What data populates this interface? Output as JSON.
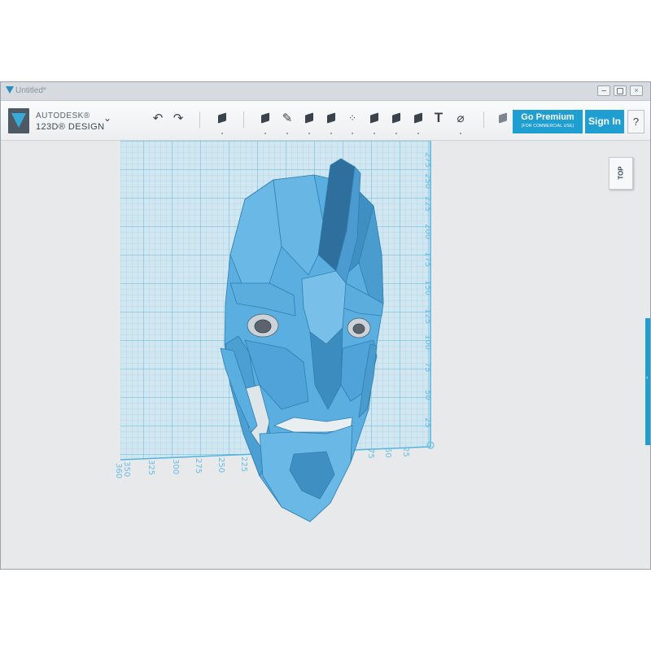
{
  "window": {
    "title": "Untitled*"
  },
  "brand": {
    "line1": "AUTODESK®",
    "line2": "123D® DESIGN"
  },
  "toolbar": {
    "menu_icon": "chevron-down-icon",
    "tools": [
      "undo-icon",
      "redo-icon",
      "transform-icon",
      "primitives-icon",
      "sketch-icon",
      "construct-icon",
      "modify-icon",
      "pattern-icon",
      "grouping-icon",
      "combine-icon",
      "measure-icon",
      "text-icon",
      "snap-icon",
      "material-icon"
    ],
    "go_premium": {
      "label": "Go Premium",
      "sub": "(FOR COMMERCIAL USE)"
    },
    "sign_in": "Sign In",
    "help": "?"
  },
  "viewcube": {
    "label": "TOP"
  },
  "grid": {
    "vertical_labels": [
      "275",
      "250",
      "225",
      "200",
      "175",
      "150",
      "125",
      "100",
      "75",
      "50",
      "25"
    ],
    "horizontal_labels": [
      "350",
      "325",
      "300",
      "275",
      "250",
      "225",
      "75",
      "50",
      "25"
    ],
    "corner_label": "360"
  },
  "model": {
    "name": "helmet-mesh",
    "color": "#4ea6d9"
  },
  "colors": {
    "accent": "#1f9fd1",
    "grid": "#6fc3e6",
    "viewport": "#e8e9ea"
  }
}
